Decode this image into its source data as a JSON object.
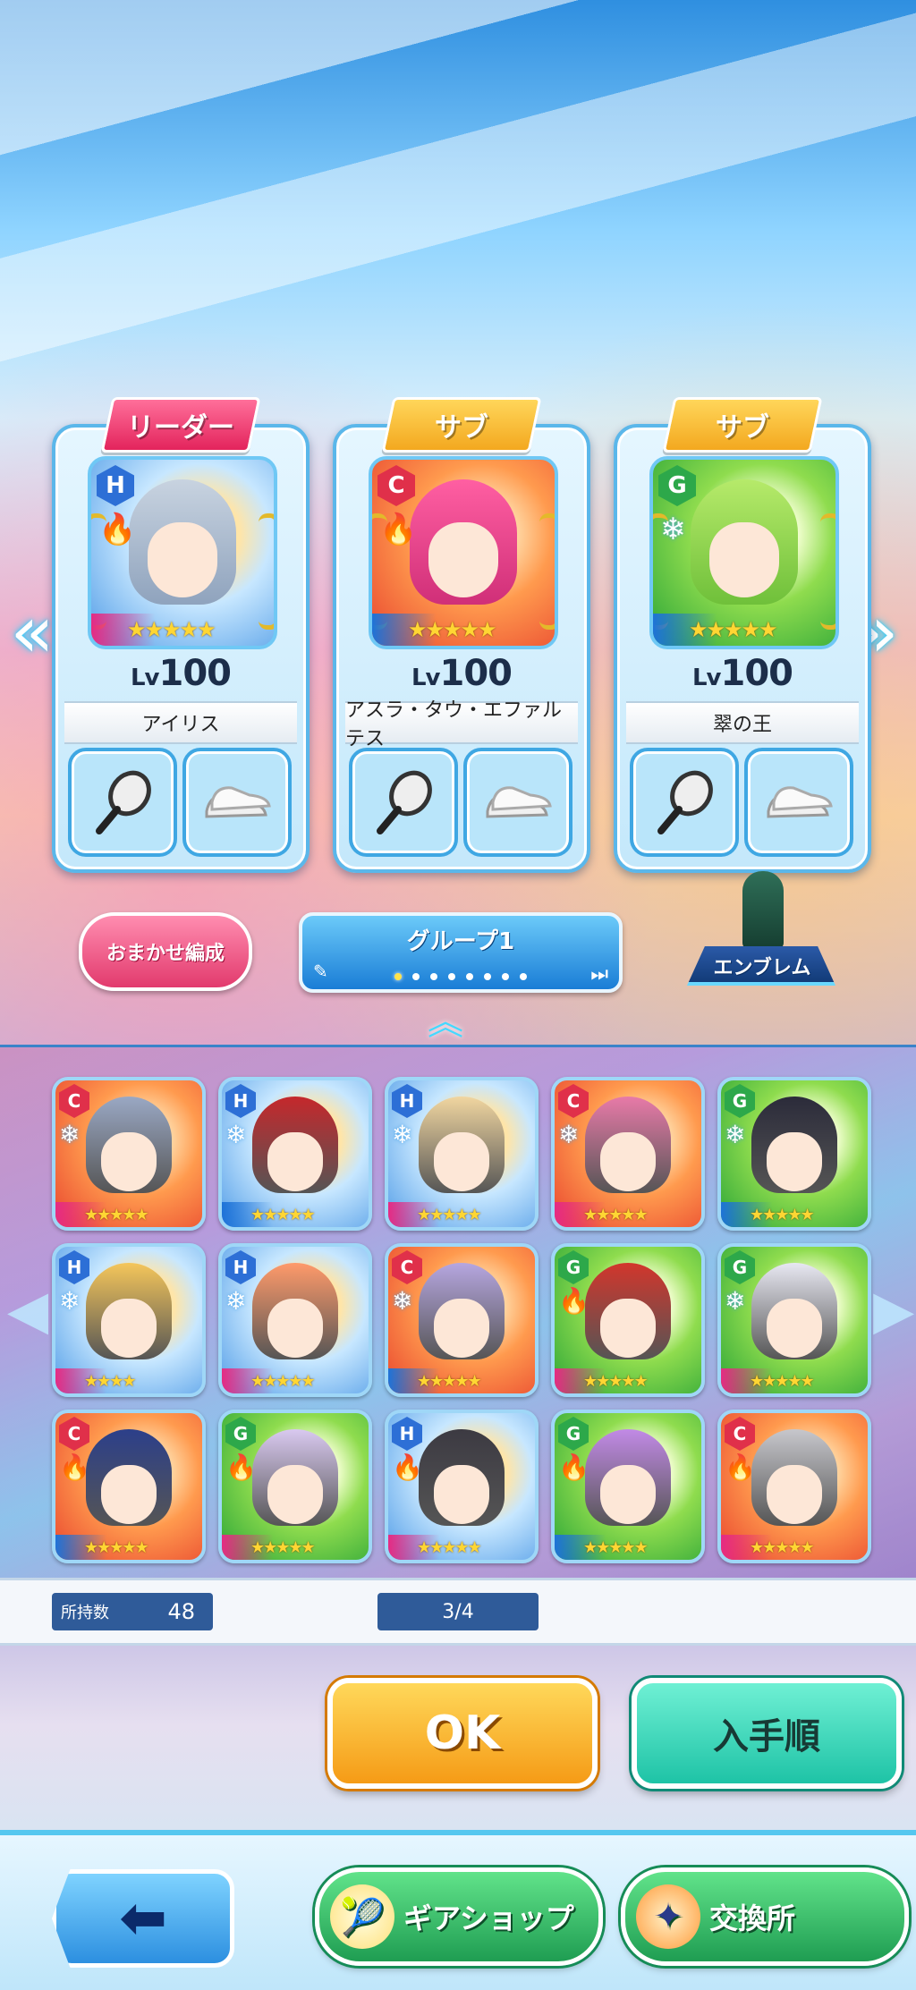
{
  "team": {
    "members": [
      {
        "role": "リーダー",
        "type": "H",
        "element": "🔥",
        "stars": "★★★★★",
        "level_prefix": "Lv",
        "level": "100",
        "name": "アイリス"
      },
      {
        "role": "サブ",
        "type": "C",
        "element": "🔥",
        "stars": "★★★★★",
        "level_prefix": "Lv",
        "level": "100",
        "name": "アスラ・タウ・エファルテス"
      },
      {
        "role": "サブ",
        "type": "G",
        "element": "❄",
        "stars": "★★★★★",
        "level_prefix": "Lv",
        "level": "100",
        "name": "翠の王"
      }
    ]
  },
  "controls": {
    "auto_label": "おまかせ編成",
    "group_label": "グループ1",
    "emblem_label": "エンブレム"
  },
  "roster": {
    "cards": [
      {
        "type": "C",
        "element": "❄",
        "stars": "★★★★★"
      },
      {
        "type": "H",
        "element": "❄",
        "stars": "★★★★★"
      },
      {
        "type": "H",
        "element": "❄",
        "stars": "★★★★★"
      },
      {
        "type": "C",
        "element": "❄",
        "stars": "★★★★★"
      },
      {
        "type": "G",
        "element": "❄",
        "stars": "★★★★★"
      },
      {
        "type": "H",
        "element": "❄",
        "stars": "★★★★"
      },
      {
        "type": "H",
        "element": "❄",
        "stars": "★★★★★"
      },
      {
        "type": "C",
        "element": "❄",
        "stars": "★★★★★"
      },
      {
        "type": "G",
        "element": "🔥",
        "stars": "★★★★★"
      },
      {
        "type": "G",
        "element": "❄",
        "stars": "★★★★★"
      },
      {
        "type": "C",
        "element": "🔥",
        "stars": "★★★★★"
      },
      {
        "type": "G",
        "element": "🔥",
        "stars": "★★★★★"
      },
      {
        "type": "H",
        "element": "🔥",
        "stars": "★★★★★"
      },
      {
        "type": "G",
        "element": "🔥",
        "stars": "★★★★★"
      },
      {
        "type": "C",
        "element": "🔥",
        "stars": "★★★★★"
      }
    ]
  },
  "status": {
    "owned_label": "所持数",
    "owned_count": "48",
    "page": "3/4"
  },
  "actions": {
    "ok_label": "OK",
    "sort_label": "入手順"
  },
  "footer": {
    "back_glyph": "⬅",
    "gear_shop_label": "ギアショップ",
    "exchange_label": "交換所"
  },
  "colors": {
    "leader_tag": "#e3245c",
    "sub_tag": "#f3a81f",
    "type_h": "#2d6fd6",
    "type_c": "#e0304a",
    "type_g": "#2da84a",
    "ok_button": "#f59b16",
    "sort_button": "#1ec3a6",
    "footer_button": "#1f9d52"
  }
}
